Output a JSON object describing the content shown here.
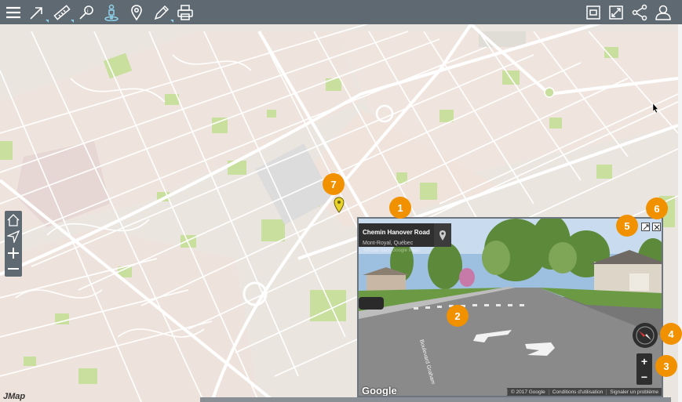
{
  "toolbar": {
    "menu_icon": "hamburger-menu-icon",
    "left_tools": [
      {
        "name": "navigate-tool-icon"
      },
      {
        "name": "measure-tool-icon"
      },
      {
        "name": "query-tool-icon"
      },
      {
        "name": "streetview-pegman-icon"
      },
      {
        "name": "location-pin-icon"
      },
      {
        "name": "draw-tool-icon"
      },
      {
        "name": "print-icon"
      }
    ],
    "right_tools": [
      {
        "name": "extent-icon"
      },
      {
        "name": "fullscreen-icon"
      },
      {
        "name": "share-icon"
      },
      {
        "name": "user-icon"
      }
    ],
    "colors": {
      "bar": "#5f6971",
      "icon": "#ffffff",
      "active": "#8fd0ea"
    }
  },
  "map_controls": {
    "items": [
      {
        "name": "home-icon"
      },
      {
        "name": "locate-icon"
      },
      {
        "name": "zoom-in-icon"
      },
      {
        "name": "zoom-out-icon"
      }
    ]
  },
  "badges": [
    "1",
    "2",
    "3",
    "4",
    "5",
    "6",
    "7"
  ],
  "streetview": {
    "road_name": "Chemin Hanover Road",
    "locality": "Mont-Royal, Québec",
    "watermark": "Afficher dans Google Maps",
    "street_label": "Boulevard Graham",
    "zoom_in": "+",
    "zoom_out": "−",
    "google": "Google",
    "footer": [
      "© 2017 Google",
      "Conditions d'utilisation",
      "Signaler un problème"
    ]
  },
  "branding": {
    "logo": "JMap"
  },
  "colors": {
    "badge": "#f29100",
    "marker": "#e8d12a",
    "map_bg": "#eae6df",
    "park": "#c8df9e"
  }
}
